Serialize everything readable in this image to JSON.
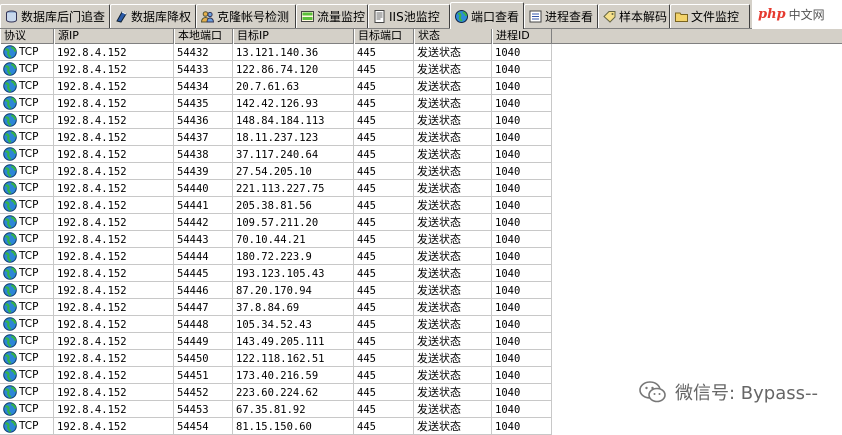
{
  "tabs": [
    {
      "label": "数据库后门追查",
      "icon": "database-icon",
      "active": false
    },
    {
      "label": "数据库降权",
      "icon": "database-blue-icon",
      "active": false
    },
    {
      "label": "克隆帐号检测",
      "icon": "users-icon",
      "active": false
    },
    {
      "label": "流量监控",
      "icon": "traffic-icon",
      "active": false
    },
    {
      "label": "IIS池监控",
      "icon": "document-icon",
      "active": false
    },
    {
      "label": "端口查看",
      "icon": "globe-icon",
      "active": true
    },
    {
      "label": "进程查看",
      "icon": "list-icon",
      "active": false
    },
    {
      "label": "样本解码",
      "icon": "tag-icon",
      "active": false
    },
    {
      "label": "文件监控",
      "icon": "folder-icon",
      "active": false
    }
  ],
  "watermark": {
    "php": "php",
    "cn": "中文网",
    "wechat": "微信号: Bypass--"
  },
  "columns": [
    "协议",
    "源IP",
    "本地端口",
    "目标IP",
    "目标端口",
    "状态",
    "进程ID"
  ],
  "rows": [
    [
      "TCP",
      "192.8.4.152",
      "54432",
      "13.121.140.36",
      "445",
      "发送状态",
      "1040"
    ],
    [
      "TCP",
      "192.8.4.152",
      "54433",
      "122.86.74.120",
      "445",
      "发送状态",
      "1040"
    ],
    [
      "TCP",
      "192.8.4.152",
      "54434",
      "20.7.61.63",
      "445",
      "发送状态",
      "1040"
    ],
    [
      "TCP",
      "192.8.4.152",
      "54435",
      "142.42.126.93",
      "445",
      "发送状态",
      "1040"
    ],
    [
      "TCP",
      "192.8.4.152",
      "54436",
      "148.84.184.113",
      "445",
      "发送状态",
      "1040"
    ],
    [
      "TCP",
      "192.8.4.152",
      "54437",
      "18.11.237.123",
      "445",
      "发送状态",
      "1040"
    ],
    [
      "TCP",
      "192.8.4.152",
      "54438",
      "37.117.240.64",
      "445",
      "发送状态",
      "1040"
    ],
    [
      "TCP",
      "192.8.4.152",
      "54439",
      "27.54.205.10",
      "445",
      "发送状态",
      "1040"
    ],
    [
      "TCP",
      "192.8.4.152",
      "54440",
      "221.113.227.75",
      "445",
      "发送状态",
      "1040"
    ],
    [
      "TCP",
      "192.8.4.152",
      "54441",
      "205.38.81.56",
      "445",
      "发送状态",
      "1040"
    ],
    [
      "TCP",
      "192.8.4.152",
      "54442",
      "109.57.211.20",
      "445",
      "发送状态",
      "1040"
    ],
    [
      "TCP",
      "192.8.4.152",
      "54443",
      "70.10.44.21",
      "445",
      "发送状态",
      "1040"
    ],
    [
      "TCP",
      "192.8.4.152",
      "54444",
      "180.72.223.9",
      "445",
      "发送状态",
      "1040"
    ],
    [
      "TCP",
      "192.8.4.152",
      "54445",
      "193.123.105.43",
      "445",
      "发送状态",
      "1040"
    ],
    [
      "TCP",
      "192.8.4.152",
      "54446",
      "87.20.170.94",
      "445",
      "发送状态",
      "1040"
    ],
    [
      "TCP",
      "192.8.4.152",
      "54447",
      "37.8.84.69",
      "445",
      "发送状态",
      "1040"
    ],
    [
      "TCP",
      "192.8.4.152",
      "54448",
      "105.34.52.43",
      "445",
      "发送状态",
      "1040"
    ],
    [
      "TCP",
      "192.8.4.152",
      "54449",
      "143.49.205.111",
      "445",
      "发送状态",
      "1040"
    ],
    [
      "TCP",
      "192.8.4.152",
      "54450",
      "122.118.162.51",
      "445",
      "发送状态",
      "1040"
    ],
    [
      "TCP",
      "192.8.4.152",
      "54451",
      "173.40.216.59",
      "445",
      "发送状态",
      "1040"
    ],
    [
      "TCP",
      "192.8.4.152",
      "54452",
      "223.60.224.62",
      "445",
      "发送状态",
      "1040"
    ],
    [
      "TCP",
      "192.8.4.152",
      "54453",
      "67.35.81.92",
      "445",
      "发送状态",
      "1040"
    ],
    [
      "TCP",
      "192.8.4.152",
      "54454",
      "81.15.150.60",
      "445",
      "发送状态",
      "1040"
    ]
  ]
}
